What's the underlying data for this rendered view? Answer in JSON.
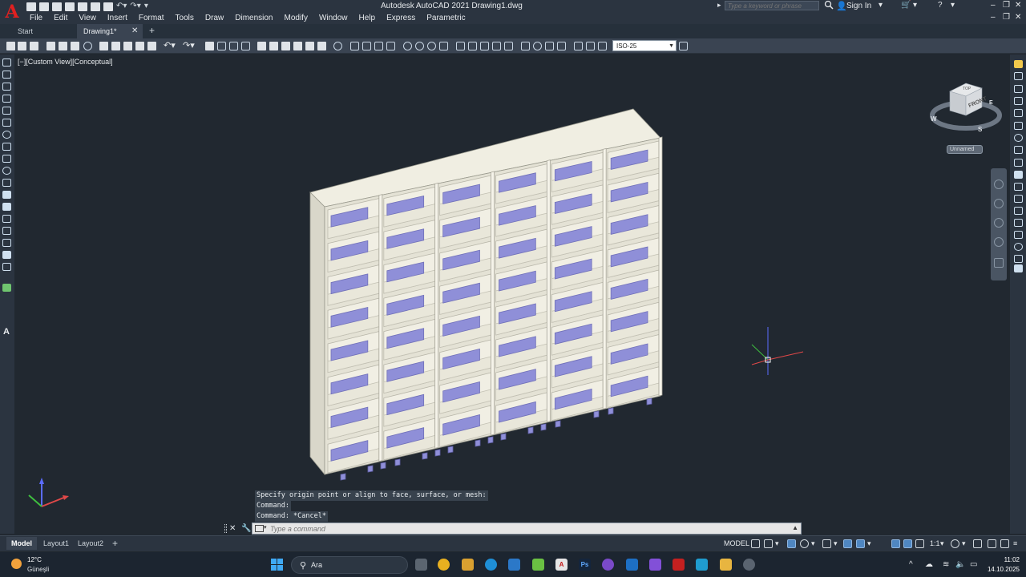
{
  "app": {
    "window_title": "Autodesk AutoCAD 2021    Drawing1.dwg",
    "logo_letter": "A",
    "colors": {
      "accent": "#e02020",
      "background": "#212830",
      "panel": "#2b3440",
      "cabinet_face": "#ebe9dc",
      "panel_inset": "#8f8fd8"
    }
  },
  "menu": [
    "File",
    "Edit",
    "View",
    "Insert",
    "Format",
    "Tools",
    "Draw",
    "Dimension",
    "Modify",
    "Window",
    "Help",
    "Express",
    "Parametric"
  ],
  "search": {
    "placeholder": "Type a keyword or phrase"
  },
  "account": {
    "sign_in_label": "Sign In"
  },
  "tabs": {
    "start": "Start",
    "drawing": "Drawing1*",
    "close": "✕",
    "add": "+"
  },
  "toolbar": {
    "dim_style": "ISO-25"
  },
  "viewport": {
    "label": "[−][Custom View][Conceptual]"
  },
  "viewcube": {
    "face_label": "FRONT",
    "top_label": "TOP",
    "compass": {
      "west": "W",
      "south": "S",
      "east": "E"
    },
    "ucs_label": "Unnamed"
  },
  "command": {
    "history": [
      "Specify origin point or align to face, surface, or mesh:",
      "Command:",
      "Command: *Cancel*"
    ],
    "placeholder": "Type a command"
  },
  "layouts": {
    "model": "Model",
    "layout1": "Layout1",
    "layout2": "Layout2",
    "add": "+"
  },
  "status": {
    "space": "MODEL",
    "scale": "1:1"
  },
  "taskbar": {
    "weather_temp": "12°C",
    "weather_text": "Güneşli",
    "search_label": "Ara",
    "time": "11:02",
    "date": "14.10.2025"
  }
}
